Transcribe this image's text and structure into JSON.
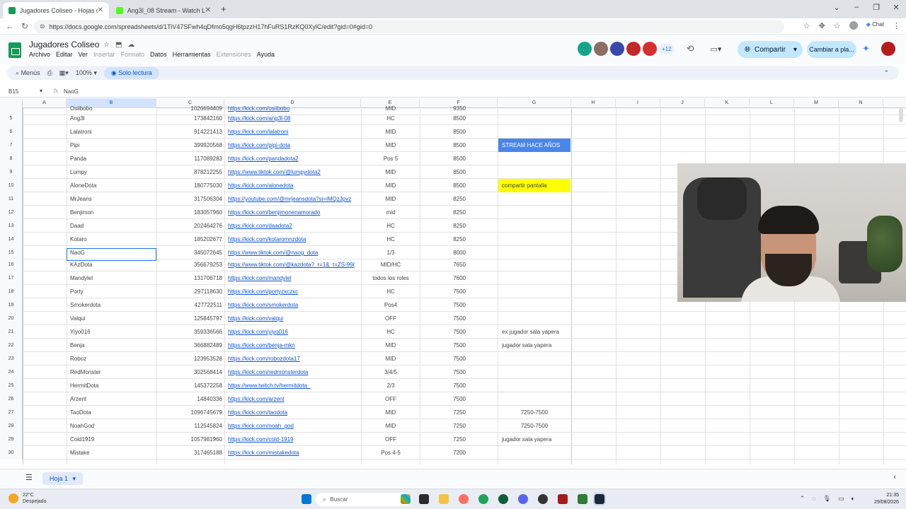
{
  "browser": {
    "tabs": [
      {
        "title": "Jugadores Coliseo - Hojas de cálc",
        "active": true,
        "color": "#0f9d58"
      },
      {
        "title": "Ang3l_08 Stream - Watch Live on K",
        "active": false,
        "color": "#53fc18"
      }
    ],
    "url": "https://docs.google.com/spreadsheets/d/1TiV47SFwh4qDfmo5qgH6tpzzH17hFuRS1RzKQ0XylC/edit?gid=0#gid=0",
    "chat_label": "Chat"
  },
  "app": {
    "title": "Jugadores Coliseo",
    "menu": [
      "Archivo",
      "Editar",
      "Ver",
      "Insertar",
      "Formato",
      "Datos",
      "Herramientas",
      "Extensiones",
      "Ayuda"
    ],
    "disabled_menu": [
      "Insertar",
      "Formato",
      "Extensiones"
    ],
    "collaborators_extra": "+12",
    "share_label": "Compartir",
    "plan_label": "Cambiar a pla..."
  },
  "toolbar": {
    "menus_label": "Menús",
    "zoom": "100%",
    "readonly_label": "Solo lectura"
  },
  "formula_bar": {
    "cell_ref": "B15",
    "fx": "fx",
    "value": "NaoG"
  },
  "columns": [
    "A",
    "B",
    "C",
    "D",
    "E",
    "F",
    "G",
    "H",
    "I",
    "J",
    "K",
    "L",
    "M",
    "N"
  ],
  "selected_column": "B",
  "rows": [
    {
      "n": "",
      "b": "Osiibobo",
      "c": "1026694409",
      "d": "https://kick.com/osiibobo",
      "e": "MID",
      "f": "9350",
      "g": "",
      "gstyle": ""
    },
    {
      "n": "5",
      "b": "Ang3l",
      "c": "173842160",
      "d": "https://kick.com/ang3l-08",
      "e": "HC",
      "f": "8500",
      "g": "",
      "gstyle": ""
    },
    {
      "n": "6",
      "b": "Lalatroni",
      "c": "914221413",
      "d": "https://kick.com/lalatroni",
      "e": "MID",
      "f": "8500",
      "g": "",
      "gstyle": ""
    },
    {
      "n": "7",
      "b": "Pipi",
      "c": "399920568",
      "d": "https://kick.com/pipi-dota",
      "e": "MID",
      "f": "8500",
      "g": "STREAM HACE AÑOS",
      "gstyle": "blue"
    },
    {
      "n": "8",
      "b": "Panda",
      "c": "117089283",
      "d": "https://kick.com/pandadota2",
      "e": "Pos 5",
      "f": "8500",
      "g": "",
      "gstyle": ""
    },
    {
      "n": "9",
      "b": "Lumpy",
      "c": "878212255",
      "d": "https://www.tiktok.com/@lumpydota2",
      "e": "MID",
      "f": "8500",
      "g": "",
      "gstyle": ""
    },
    {
      "n": "10",
      "b": "AloneDota",
      "c": "180775030",
      "d": "https://kick.com/alonedota",
      "e": "MID",
      "f": "8500",
      "g": "compartir pantalla",
      "gstyle": "yellow"
    },
    {
      "n": "11",
      "b": "MrJeans",
      "c": "317506304",
      "d": "https://youtube.com/@mrjeansdota?si=iMQzJpvz",
      "e": "MID",
      "f": "8250",
      "g": "",
      "gstyle": ""
    },
    {
      "n": "12",
      "b": "Benjimon",
      "c": "183057960",
      "d": "https://kick.com/benjimonenamorado",
      "e": "mid",
      "f": "8250",
      "g": "",
      "gstyle": ""
    },
    {
      "n": "13",
      "b": "Daad",
      "c": "202464276",
      "d": "https://kick.com/daadota2",
      "e": "HC",
      "f": "8250",
      "g": "",
      "gstyle": ""
    },
    {
      "n": "14",
      "b": "Kotaro",
      "c": "185202677",
      "d": "https://kick.com/kotaromnzdota",
      "e": "HC",
      "f": "8250",
      "g": "",
      "gstyle": ""
    },
    {
      "n": "15",
      "b": "NaoG",
      "c": "345072645",
      "d": "https://www.tiktok.com/@naog_dota",
      "e": "1/3",
      "f": "8000",
      "g": "",
      "gstyle": ""
    },
    {
      "n": "16",
      "b": "KAzDota",
      "c": "356679253",
      "d": "https://www.tiktok.com/@kazdota?_r=1&_t=ZS-99(",
      "e": "MID/HC",
      "f": "7650",
      "g": "",
      "gstyle": ""
    },
    {
      "n": "17",
      "b": "Mandylel",
      "c": "131706718",
      "d": "https://kick.com/mandylel",
      "e": "todos los roles",
      "f": "7600",
      "g": "",
      "gstyle": ""
    },
    {
      "n": "18",
      "b": "Porty",
      "c": "297118630",
      "d": "https://kick.com/portyzxczxc",
      "e": "HC",
      "f": "7500",
      "g": "",
      "gstyle": ""
    },
    {
      "n": "19",
      "b": "Smokerdota",
      "c": "427722511",
      "d": "https://kick.com/smokerdota",
      "e": "Pos4",
      "f": "7500",
      "g": "",
      "gstyle": ""
    },
    {
      "n": "20",
      "b": "Valqui",
      "c": "125845797",
      "d": "https://kick.com/valqui",
      "e": "OFF",
      "f": "7500",
      "g": "",
      "gstyle": ""
    },
    {
      "n": "21",
      "b": "Yiyo016",
      "c": "359336566",
      "d": "https://kick.com/yiyo016",
      "e": "HC",
      "f": "7500",
      "g": "ex jugador sala yapera",
      "gstyle": ""
    },
    {
      "n": "22",
      "b": "Benja",
      "c": "366882489",
      "d": "https://kick.com/benja-mkn",
      "e": "MID",
      "f": "7500",
      "g": "jugador sala yapera",
      "gstyle": ""
    },
    {
      "n": "23",
      "b": "Roboz",
      "c": "123953528",
      "d": "https://kick.com/robozdota17",
      "e": "MID",
      "f": "7500",
      "g": "",
      "gstyle": ""
    },
    {
      "n": "24",
      "b": "RedMonster",
      "c": "302568414",
      "d": "https://kick.com/redmonsterdota",
      "e": "3/4/5",
      "f": "7500",
      "g": "",
      "gstyle": ""
    },
    {
      "n": "25",
      "b": "HermitDota",
      "c": "145372258",
      "d": "https://www.twitch.tv/hermitdota_",
      "e": "2/3",
      "f": "7500",
      "g": "",
      "gstyle": ""
    },
    {
      "n": "26",
      "b": "Arzent",
      "c": "14840336",
      "d": "https://kick.com/arzent",
      "e": "OFF",
      "f": "7500",
      "g": "",
      "gstyle": ""
    },
    {
      "n": "27",
      "b": "TaoDota",
      "c": "1096745679",
      "d": "https://kick.com/taodota",
      "e": "MID",
      "f": "7250",
      "g": "7250-7500",
      "gstyle": "center"
    },
    {
      "n": "28",
      "b": "NoahGod",
      "c": "112545824",
      "d": "https://kick.com/noah_god",
      "e": "MID",
      "f": "7250",
      "g": "7250-7500",
      "gstyle": "center"
    },
    {
      "n": "29",
      "b": "Cold1919",
      "c": "1057981960",
      "d": "https://kick.com/cold-1919",
      "e": "OFF",
      "f": "7250",
      "g": "jugador sala yapera",
      "gstyle": ""
    },
    {
      "n": "30",
      "b": "Mistake",
      "c": "317465188",
      "d": "https://kick.com/mistakedota",
      "e": "Pos 4-5",
      "f": "7200",
      "g": "",
      "gstyle": ""
    }
  ],
  "sheet": {
    "tab_label": "Hoja 1"
  },
  "taskbar": {
    "temperature": "22°C",
    "weather_text": "Despejado",
    "search_placeholder": "Buscar",
    "time": "21:35",
    "date": "29/08/2026"
  }
}
